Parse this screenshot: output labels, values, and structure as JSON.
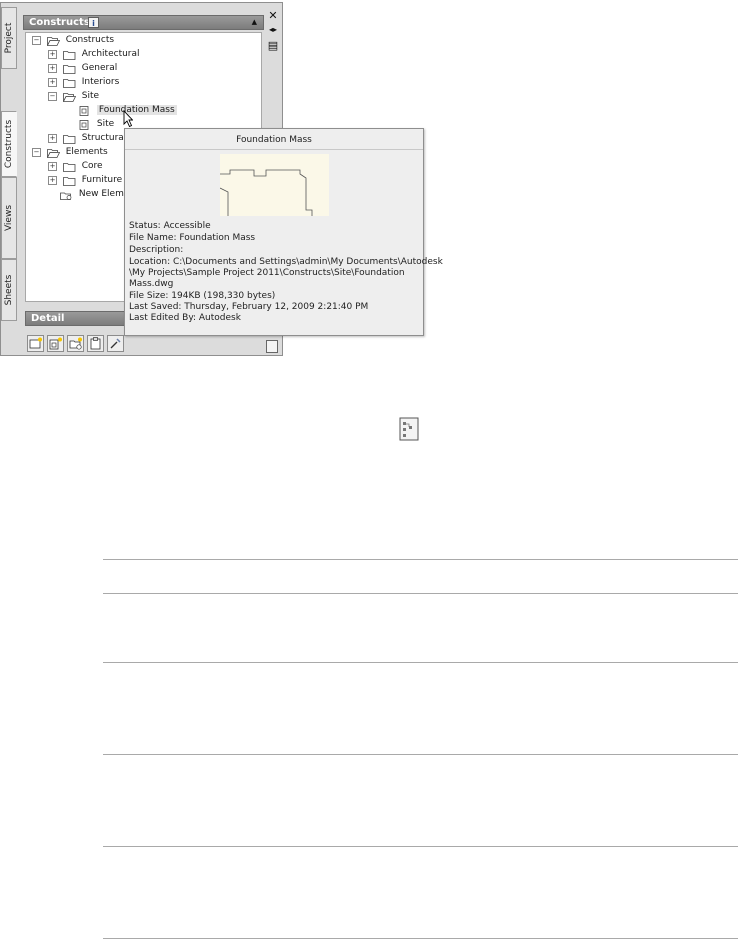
{
  "palette": {
    "tabs": [
      "Project",
      "Constructs",
      "Views",
      "Sheets"
    ],
    "active_tab": "Constructs",
    "section_title": "Constructs",
    "info_badge": "i",
    "collapse_glyph": "▲",
    "tree": [
      {
        "label": "Constructs",
        "icon": "folder-open-icon",
        "expander": "−"
      },
      {
        "label": "Architectural",
        "icon": "folder-icon",
        "expander": "+"
      },
      {
        "label": "General",
        "icon": "folder-icon",
        "expander": "+"
      },
      {
        "label": "Interiors",
        "icon": "folder-icon",
        "expander": "+"
      },
      {
        "label": "Site",
        "icon": "folder-open-icon",
        "expander": "−"
      },
      {
        "label": "Foundation Mass",
        "icon": "construct-file-icon",
        "selected": true
      },
      {
        "label": "Site",
        "icon": "construct-file-icon"
      },
      {
        "label": "Structural",
        "icon": "folder-icon",
        "expander": "+"
      },
      {
        "label": "Elements",
        "icon": "folder-open-icon",
        "expander": "−"
      },
      {
        "label": "Core",
        "icon": "folder-icon",
        "expander": "+"
      },
      {
        "label": "Furniture",
        "icon": "folder-icon",
        "expander": "+"
      },
      {
        "label": "New Eleme",
        "icon": "new-element-icon"
      }
    ],
    "detail_title": "Detail",
    "toolbar_icons": [
      "new-construct-icon",
      "new-element-icon",
      "new-category-icon",
      "paste-icon",
      "tools-icon"
    ],
    "side_controls": {
      "close_glyph": "✕",
      "autohide_glyph": "◂▸",
      "properties_glyph": "▤"
    }
  },
  "tooltip": {
    "title": "Foundation Mass",
    "lines": [
      "Status: Accessible",
      "File Name: Foundation Mass",
      "Description:",
      "Location: C:\\Documents and Settings\\admin\\My Documents\\Autodesk",
      "\\My Projects\\Sample Project 2011\\Constructs\\Site\\Foundation",
      "Mass.dwg",
      "File Size: 194KB (198,330 bytes)",
      "Last Saved: Thursday, February 12, 2009  2:21:40 PM",
      "Last Edited By: Autodesk"
    ]
  },
  "document": {
    "icon": "project-browser-icon"
  }
}
